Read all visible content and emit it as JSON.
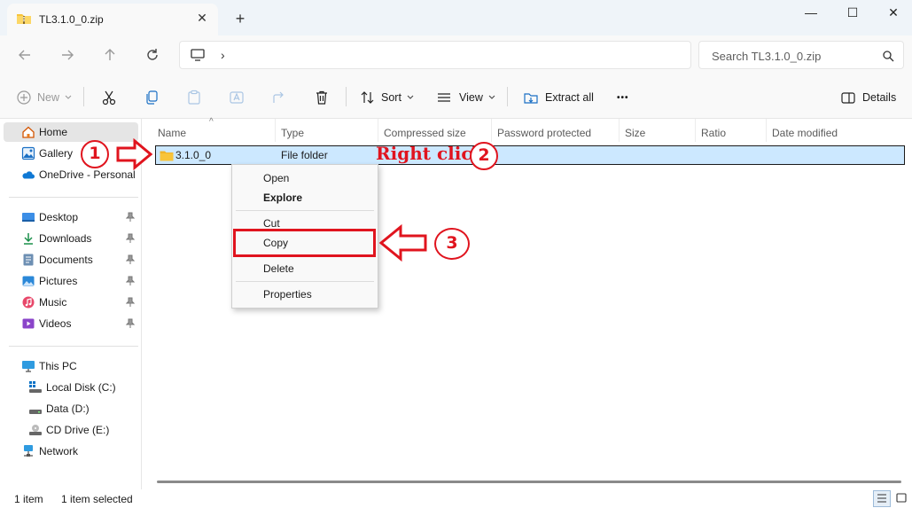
{
  "window": {
    "tab_title": "TL3.1.0_0.zip",
    "tab_close": "✕",
    "new_tab": "+",
    "minimize": "—",
    "maximize": "☐",
    "close": "✕"
  },
  "address": {
    "chevron": "›",
    "search_placeholder": "Search TL3.1.0_0.zip"
  },
  "commands": {
    "new_label": "New",
    "sort_label": "Sort",
    "view_label": "View",
    "extract_all_label": "Extract all",
    "more_label": "•••",
    "details_label": "Details"
  },
  "sidebar": {
    "items": [
      {
        "label": "Home",
        "icon": "home-icon"
      },
      {
        "label": "Gallery",
        "icon": "gallery-icon"
      },
      {
        "label": "OneDrive - Personal",
        "icon": "cloud-icon"
      },
      {
        "label": "Desktop",
        "icon": "desktop-icon"
      },
      {
        "label": "Downloads",
        "icon": "download-icon"
      },
      {
        "label": "Documents",
        "icon": "document-icon"
      },
      {
        "label": "Pictures",
        "icon": "pictures-icon"
      },
      {
        "label": "Music",
        "icon": "music-icon"
      },
      {
        "label": "Videos",
        "icon": "videos-icon"
      },
      {
        "label": "This PC",
        "icon": "computer-icon"
      },
      {
        "label": "Local Disk (C:)",
        "icon": "drive-icon"
      },
      {
        "label": "Data (D:)",
        "icon": "drive-icon"
      },
      {
        "label": "CD Drive (E:)",
        "icon": "cd-drive-icon"
      },
      {
        "label": "Network",
        "icon": "network-icon"
      }
    ]
  },
  "columns": [
    "Name",
    "Type",
    "Compressed size",
    "Password protected",
    "Size",
    "Ratio",
    "Date modified"
  ],
  "sort_caret": "^",
  "rows": [
    {
      "name": "3.1.0_0",
      "type": "File folder"
    }
  ],
  "context_menu": {
    "items": [
      "Open",
      "Explore",
      "Cut",
      "Copy",
      "Delete",
      "Properties"
    ]
  },
  "status": {
    "item_count": "1 item",
    "selected": "1 item selected"
  },
  "annotations": {
    "step1": "1",
    "step2": "2",
    "step3": "3",
    "right_click_text": "Right click"
  },
  "colors": {
    "annotation_red": "#e0141e",
    "selection_blue": "#cce8ff",
    "folder_yellow": "#f8c43a"
  }
}
